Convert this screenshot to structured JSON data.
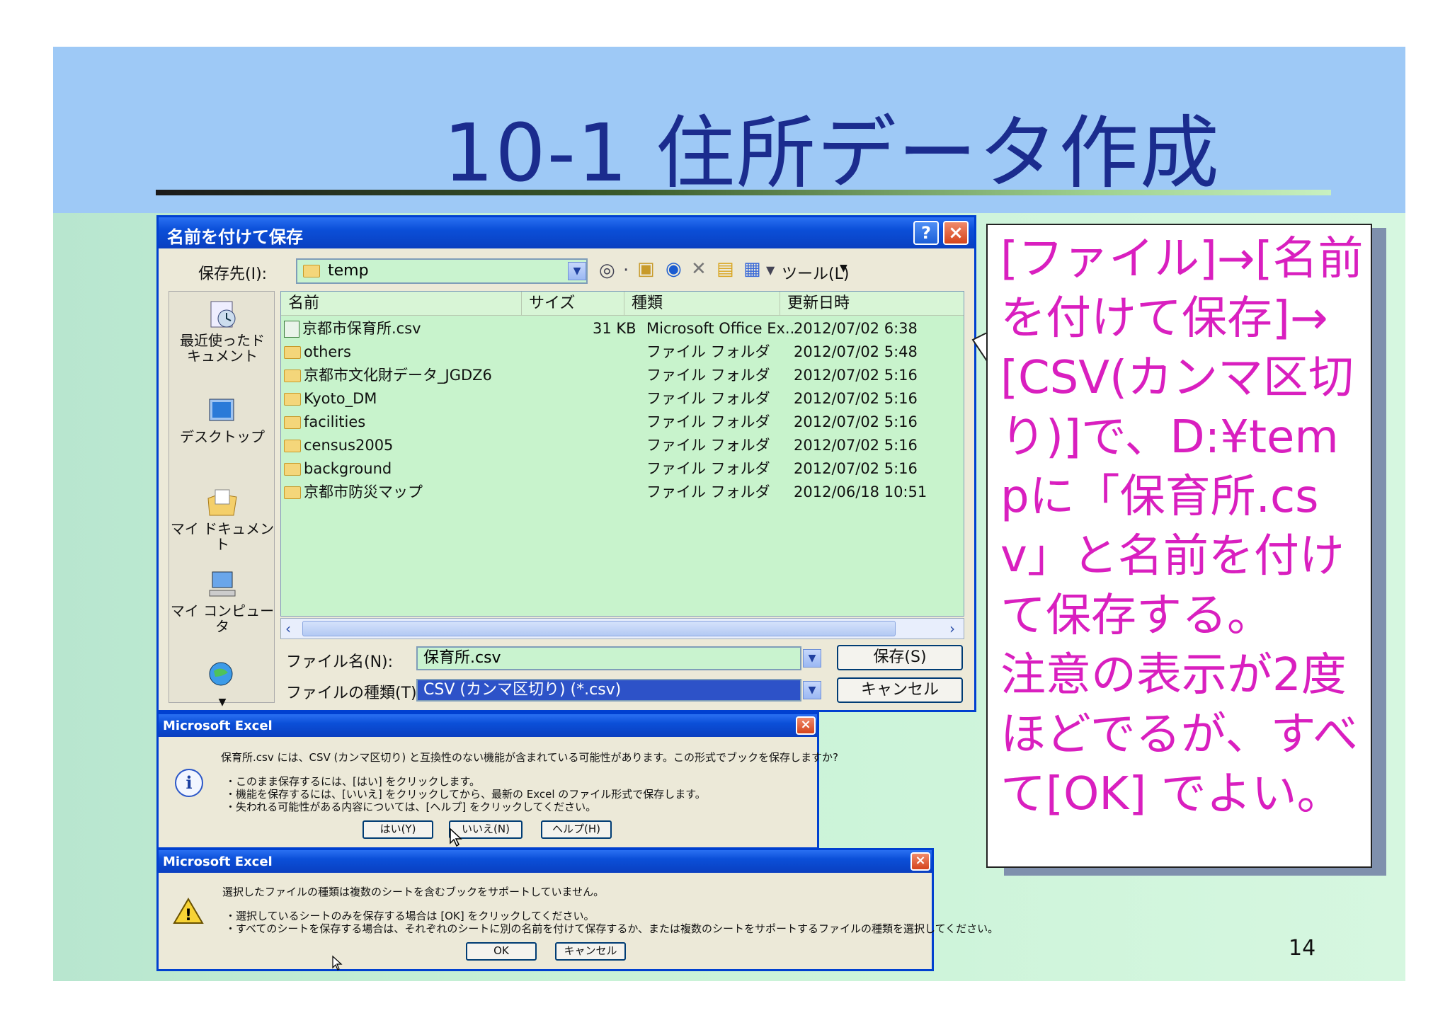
{
  "slide": {
    "title": "10-1 住所データ作成",
    "page_number": "14"
  },
  "save_dialog": {
    "title": "名前を付けて保存",
    "help_button": "?",
    "close_button": "×",
    "save_in_label": "保存先(I):",
    "save_in_value": "temp",
    "tools_label": "ツール(L)",
    "places": [
      "最近使ったド\nキュメント",
      "デスクトップ",
      "マイ ドキュメント",
      "マイ コンピュータ"
    ],
    "columns": [
      "名前",
      "サイズ",
      "種類",
      "更新日時"
    ],
    "files": [
      {
        "name": "京都市保育所.csv",
        "size": "31 KB",
        "type": "Microsoft Office Ex..",
        "modified": "2012/07/02 6:38",
        "kind": "csv"
      },
      {
        "name": "others",
        "size": "",
        "type": "ファイル フォルダ",
        "modified": "2012/07/02 5:48",
        "kind": "folder"
      },
      {
        "name": "京都市文化財データ_JGDZ6",
        "size": "",
        "type": "ファイル フォルダ",
        "modified": "2012/07/02 5:16",
        "kind": "folder"
      },
      {
        "name": "Kyoto_DM",
        "size": "",
        "type": "ファイル フォルダ",
        "modified": "2012/07/02 5:16",
        "kind": "folder"
      },
      {
        "name": "facilities",
        "size": "",
        "type": "ファイル フォルダ",
        "modified": "2012/07/02 5:16",
        "kind": "folder"
      },
      {
        "name": "census2005",
        "size": "",
        "type": "ファイル フォルダ",
        "modified": "2012/07/02 5:16",
        "kind": "folder"
      },
      {
        "name": "background",
        "size": "",
        "type": "ファイル フォルダ",
        "modified": "2012/07/02 5:16",
        "kind": "folder"
      },
      {
        "name": "京都市防災マップ",
        "size": "",
        "type": "ファイル フォルダ",
        "modified": "2012/06/18 10:51",
        "kind": "folder"
      }
    ],
    "filename_label": "ファイル名(N):",
    "filename_value": "保育所.csv",
    "filetype_label": "ファイルの種類(T):",
    "filetype_value": "CSV (カンマ区切り) (*.csv)",
    "save_button": "保存(S)",
    "cancel_button": "キャンセル"
  },
  "msg1": {
    "title": "Microsoft Excel",
    "line1": "保育所.csv には、CSV (カンマ区切り) と互換性のない機能が含まれている可能性があります。この形式でブックを保存しますか?",
    "line2": "・このまま保存するには、[はい] をクリックします。",
    "line3": "・機能を保存するには、[いいえ] をクリックしてから、最新の Excel のファイル形式で保存します。",
    "line4": "・失われる可能性がある内容については、[ヘルプ] をクリックしてください。",
    "yes_button": "はい(Y)",
    "no_button": "いいえ(N)",
    "help_button": "ヘルプ(H)"
  },
  "msg2": {
    "title": "Microsoft Excel",
    "line1": "選択したファイルの種類は複数のシートを含むブックをサポートしていません。",
    "line2": "・選択しているシートのみを保存する場合は [OK] をクリックしてください。",
    "line3": "・すべてのシートを保存する場合は、それぞれのシートに別の名前を付けて保存するか、または複数のシートをサポートするファイルの種類を選択してください。",
    "ok_button": "OK",
    "cancel_button": "キャンセル"
  },
  "callout": {
    "text": "[ファイル]→[名前を付けて保存]→[CSV(カンマ区切り)]で、D:¥tempに「保育所.csv」と名前を付けて保存する。\n注意の表示が2度ほどでるが、すべて[OK] でよい。"
  },
  "colors": {
    "slide_bg": "#9ec9f6",
    "title_color": "#1b2c8e",
    "callout_text": "#d91fbf",
    "xp_title_blue": "#0b4fd8"
  }
}
